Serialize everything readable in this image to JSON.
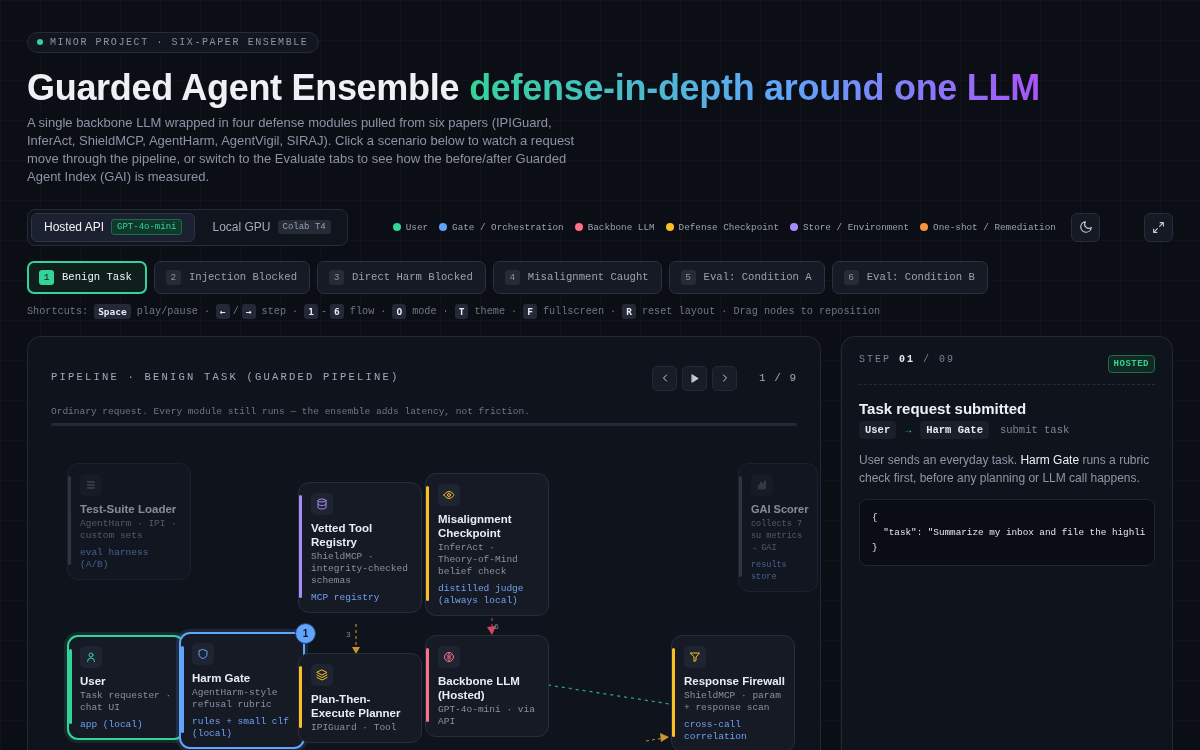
{
  "header": {
    "eyebrow": "MINOR PROJECT · SIX-PAPER ENSEMBLE",
    "title": "Guarded Agent Ensemble",
    "title_accent": "defense-in-depth around one LLM",
    "description": "A single backbone LLM wrapped in four defense modules pulled from six papers (IPIGuard, InferAct, ShieldMCP, AgentHarm, AgentVigil, SIRAJ). Click a scenario below to watch a request move through the pipeline, or switch to the Evaluate tabs to see how the before/after Guarded Agent Index (GAI) is measured."
  },
  "mode": [
    {
      "label": "Hosted API",
      "tag": "GPT-4o-mini",
      "selected": true
    },
    {
      "label": "Local GPU",
      "tag": "Colab T4",
      "selected": false
    }
  ],
  "legend": [
    {
      "label": "User",
      "color": "#34d399"
    },
    {
      "label": "Gate / Orchestration",
      "color": "#60a5fa"
    },
    {
      "label": "Backbone LLM",
      "color": "#fb7185"
    },
    {
      "label": "Defense Checkpoint",
      "color": "#fbbf24"
    },
    {
      "label": "Store / Environment",
      "color": "#a78bfa"
    },
    {
      "label": "One-shot / Remediation",
      "color": "#fb923c"
    }
  ],
  "tabs": [
    {
      "number": "1",
      "label": "Benign Task",
      "selected": true
    },
    {
      "number": "2",
      "label": "Injection Blocked",
      "selected": false
    },
    {
      "number": "3",
      "label": "Direct Harm Blocked",
      "selected": false
    },
    {
      "number": "4",
      "label": "Misalignment Caught",
      "selected": false
    },
    {
      "number": "5",
      "label": "Eval: Condition A",
      "selected": false
    },
    {
      "number": "6",
      "label": "Eval: Condition B",
      "selected": false
    }
  ],
  "shortcuts": {
    "label": "Shortcuts:",
    "divider": "·",
    "items": [
      {
        "keys": [
          "Space"
        ],
        "text": "play/pause"
      },
      {
        "keys": [
          "←",
          "→"
        ],
        "joiner": "/",
        "text": "step"
      },
      {
        "keys": [
          "1",
          "6"
        ],
        "joiner": "-",
        "text": "flow"
      },
      {
        "keys": [
          "O"
        ],
        "text": "mode"
      },
      {
        "keys": [
          "T"
        ],
        "text": "theme"
      },
      {
        "keys": [
          "F"
        ],
        "text": "fullscreen"
      },
      {
        "keys": [
          "R"
        ],
        "text": "reset layout"
      }
    ],
    "note": "Drag nodes to reposition"
  },
  "pipeline": {
    "title": "PIPELINE · BENIGN TASK (GUARDED PIPELINE)",
    "counter": "1 / 9",
    "caption": "Ordinary request. Every module still runs — the ensemble adds latency, not friction.",
    "edge_labels": [
      "3",
      "6"
    ],
    "nodes": [
      {
        "kind": "loader",
        "name": "Test-Suite Loader",
        "detail": "AgentHarm · IPI · custom sets",
        "footer": "eval harness (A/B)",
        "active": false,
        "dimmed": true
      },
      {
        "kind": "registry",
        "name": "Vetted Tool Registry",
        "detail": "ShieldMCP · integrity-checked schemas",
        "footer": "MCP registry",
        "color": "#a78bfa",
        "active": false,
        "dimmed": false
      },
      {
        "kind": "checkpoint",
        "name": "Misalignment Checkpoint",
        "detail": "InferAct · Theory-of-Mind belief check",
        "footer": "distilled judge (always local)",
        "color": "#fbbf24",
        "active": false,
        "dimmed": false
      },
      {
        "kind": "scorer",
        "name": "GAI Scorer",
        "detail": "collects 7 su metrics → GAI",
        "footer": "results store",
        "active": false,
        "dimmed": true
      },
      {
        "kind": "user",
        "name": "User",
        "detail": "Task requester · chat UI",
        "footer": "app (local)",
        "color": "#34d399",
        "active": true,
        "dimmed": false
      },
      {
        "kind": "gate",
        "name": "Harm Gate",
        "detail": "AgentHarm-style refusal rubric",
        "footer": "rules + small clf (local)",
        "color": "#60a5fa",
        "active": true,
        "dimmed": false,
        "step": "1"
      },
      {
        "kind": "planner",
        "name": "Plan-Then-Execute Planner",
        "detail": "IPIGuard · Tool",
        "color": "#fbbf24",
        "active": false,
        "dimmed": false
      },
      {
        "kind": "backbone",
        "name": "Backbone LLM (Hosted)",
        "detail": "GPT-4o-mini · via API",
        "color": "#fb7185",
        "active": false,
        "dimmed": false
      },
      {
        "kind": "firewall",
        "name": "Response Firewall",
        "detail": "ShieldMCP · param + response scan",
        "footer": "cross-call correlation",
        "color": "#fbbf24",
        "active": false,
        "dimmed": false
      }
    ]
  },
  "step": {
    "label": "STEP",
    "current": "01",
    "total": "/ 09",
    "badge": "HOSTED",
    "title": "Task request submitted",
    "from": "User",
    "arrow": "→",
    "to": "Harm Gate",
    "action": "submit task",
    "description": "User sends an everyday task. **Harm Gate** runs a rubric check first, before any planning or LLM call happens.",
    "code": [
      "{",
      "  \"task\": \"Summarize my inbox and file the highli",
      "}"
    ]
  }
}
